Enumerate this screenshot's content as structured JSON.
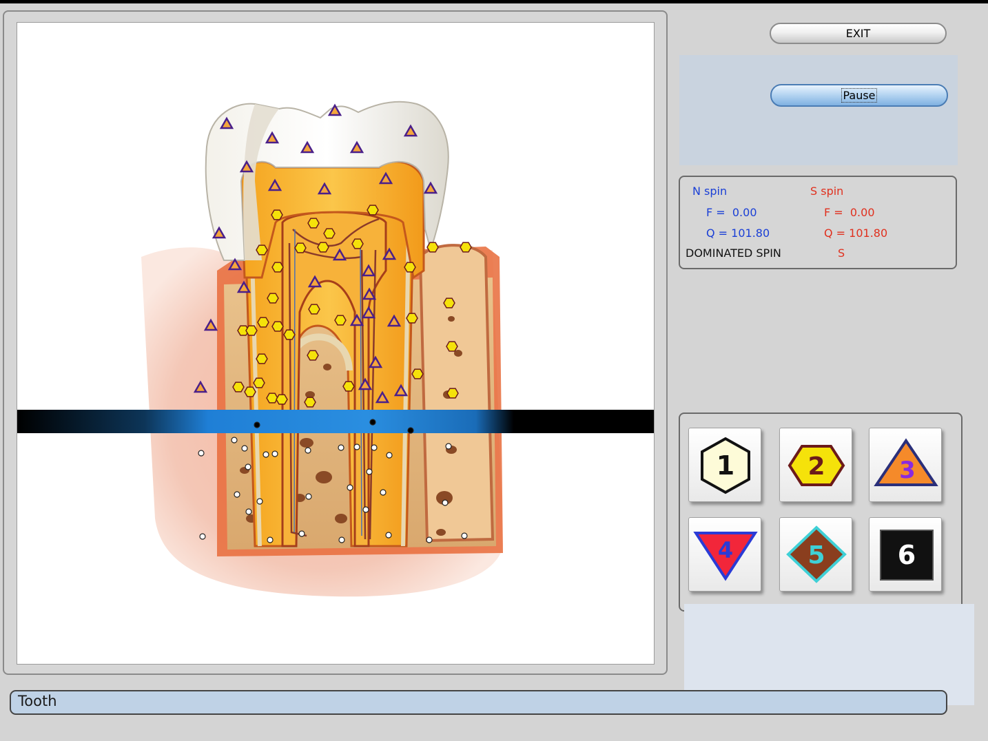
{
  "buttons": {
    "exit_label": "EXIT",
    "pause_label": "Pause"
  },
  "spin": {
    "n_title": "N spin",
    "s_title": "S spin",
    "n_f": "F =  0.00",
    "n_q": "Q = 101.80",
    "s_f": "F =  0.00",
    "s_q": "Q = 101.80",
    "dominated_label": "DOMINATED SPIN",
    "dominated_value": "S"
  },
  "shape_buttons": [
    "1",
    "2",
    "3",
    "4",
    "5",
    "6"
  ],
  "status": {
    "text": "Tooth"
  },
  "colors": {
    "n_spin": "#1a3fd6",
    "s_spin": "#e0301e",
    "scan_band": "#000000",
    "scan_glow": "#1e7fd8"
  }
}
